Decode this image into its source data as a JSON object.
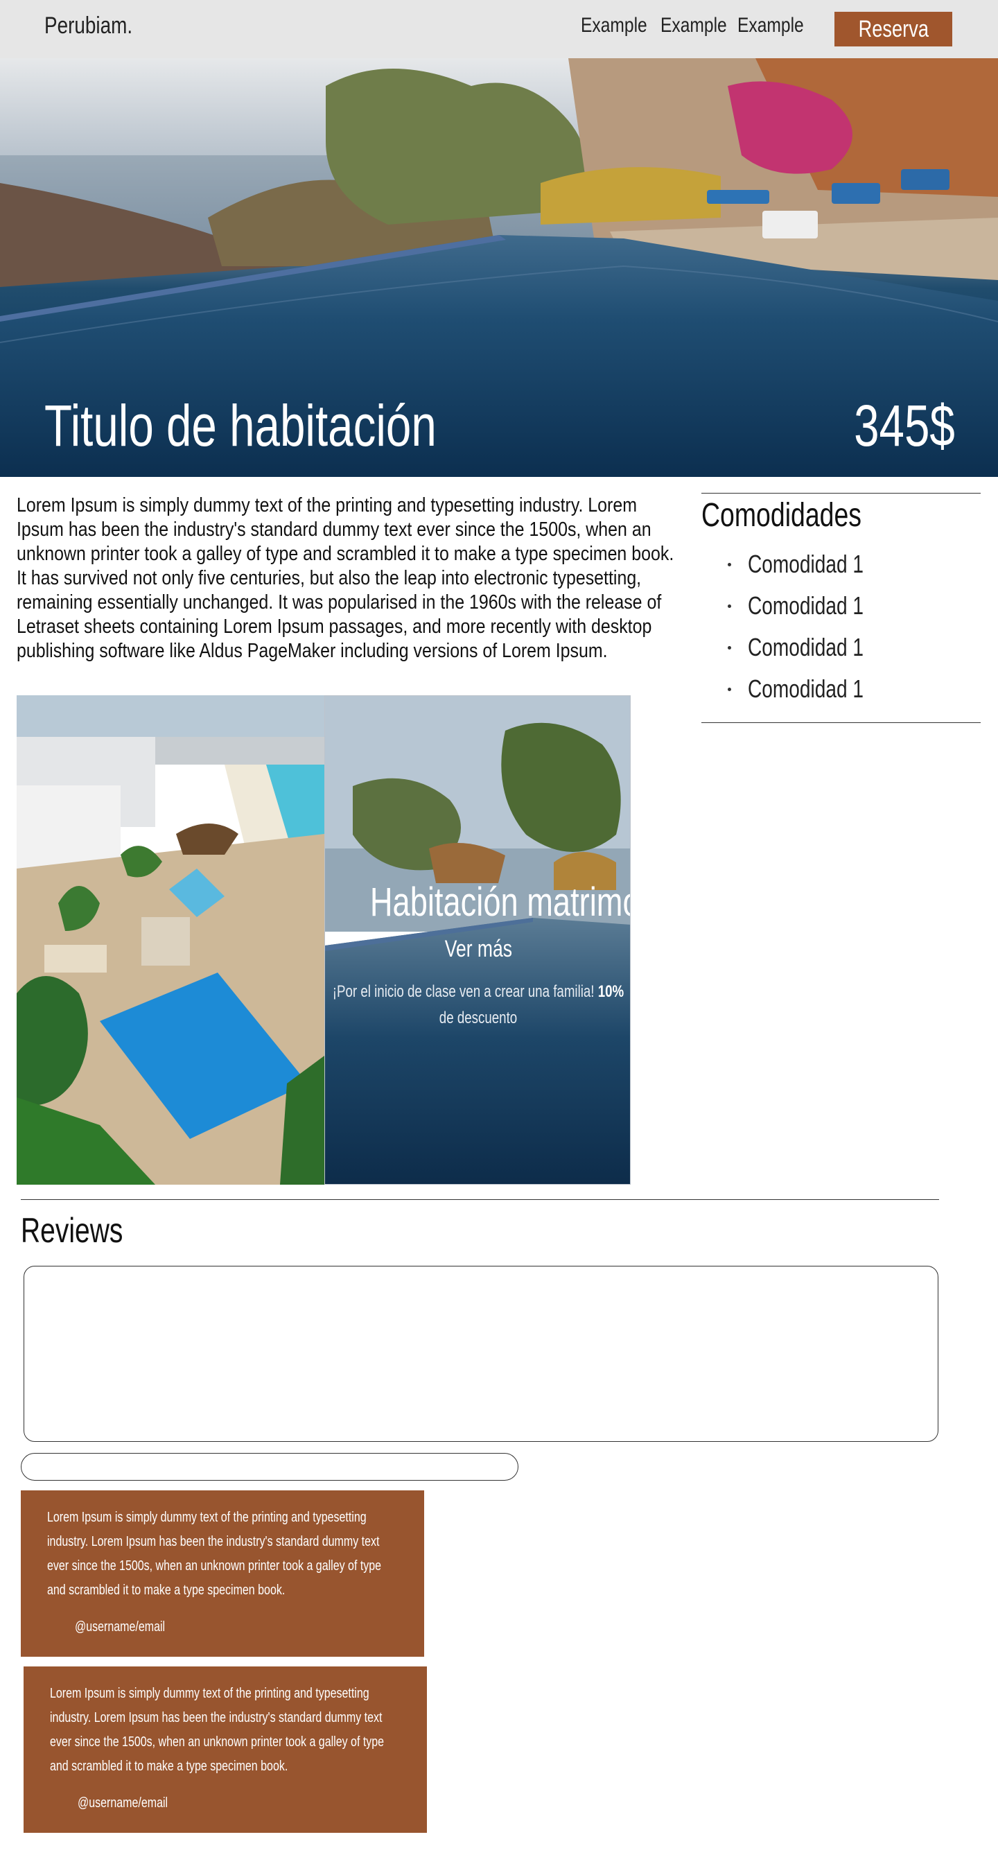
{
  "nav": {
    "logo": "Perubiam.",
    "links": [
      "Example",
      "Example",
      "Example"
    ],
    "cta_label": "Reserva",
    "cta_color": "#a0562d"
  },
  "hero": {
    "title": "Titulo de habitación",
    "price": "345$"
  },
  "description": "Lorem Ipsum is simply dummy text of the printing and typesetting industry. Lorem Ipsum has been the industry's standard dummy text ever since the 1500s, when an unknown printer took a galley of type and scrambled it to make a type specimen book. It has survived not only five centuries, but also the leap into electronic typesetting, remaining essentially unchanged. It was popularised in the 1960s with the release of Letraset sheets containing Lorem Ipsum passages, and more recently with desktop publishing software like Aldus PageMaker including versions of Lorem Ipsum.",
  "amenities": {
    "title": "Comodidades",
    "items": [
      "Comodidad 1",
      "Comodidad 1",
      "Comodidad 1",
      "Comodidad 1"
    ]
  },
  "gallery": {
    "room_title": "Habitación matrimonial",
    "more_label": "Ver más",
    "promo_text": "¡Por el inicio de clase ven a crear una familia!",
    "promo_discount": "10%",
    "promo_suffix": "de descuento"
  },
  "reviews": {
    "title": "Reviews",
    "cards": [
      {
        "text": "Lorem Ipsum is simply dummy text of the printing and typesetting industry. Lorem Ipsum has been the industry's standard dummy text ever since the 1500s, when an unknown printer took a galley of type and scrambled it to make a type specimen book.",
        "user": "@username/email"
      },
      {
        "text": "Lorem Ipsum is simply dummy text of the printing and typesetting industry. Lorem Ipsum has been the industry's standard dummy text ever since the 1500s, when an unknown printer took a galley of type and scrambled it to make a type specimen book.",
        "user": "@username/email"
      }
    ],
    "card_color": "#98552f"
  }
}
